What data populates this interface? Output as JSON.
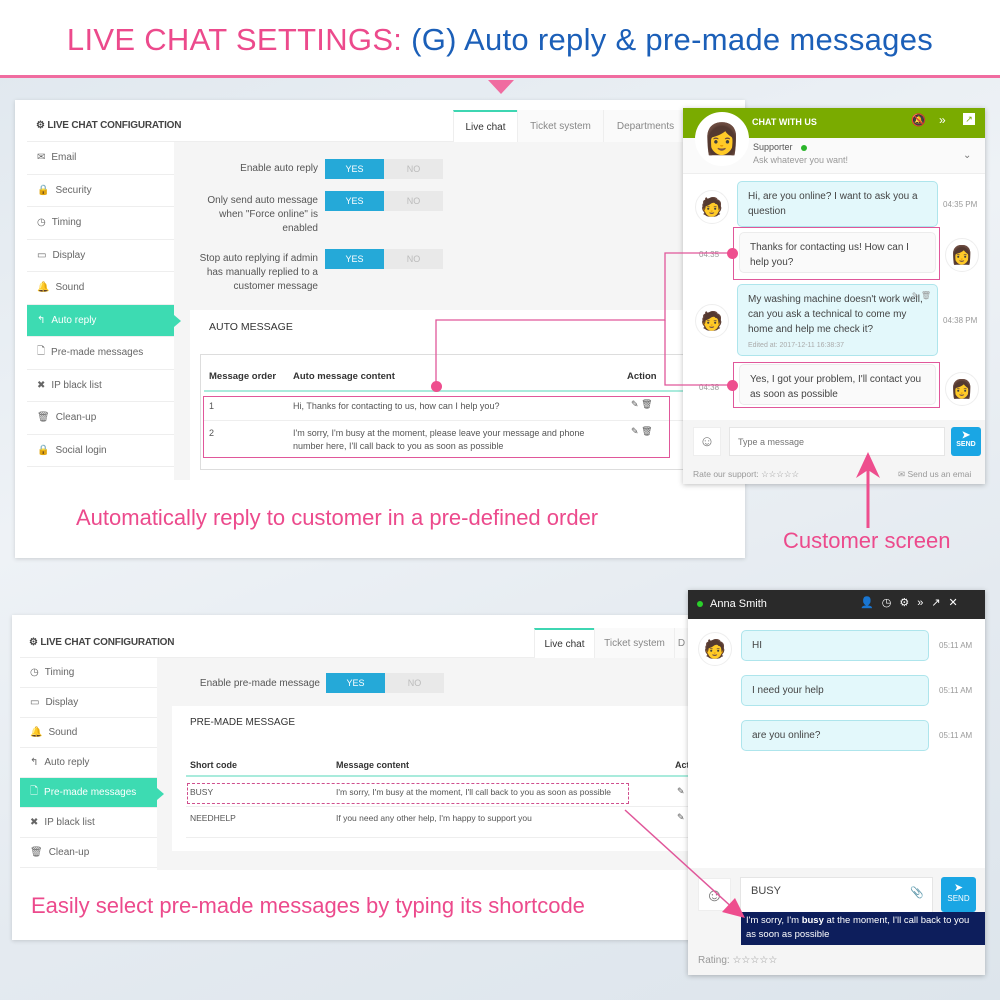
{
  "header": {
    "title_pink": "LIVE CHAT SETTINGS:",
    "title_blue": "(G) Auto reply & pre-made messages"
  },
  "colors": {
    "pink": "#ec4a8c",
    "blue": "#1b5fb8",
    "teal": "#3ddbb2",
    "toggle_yes": "#25a9d8",
    "chat_green": "#7aab00",
    "chat_dark": "#2a2a2a",
    "suggest": "#0d1e5c"
  },
  "panel1": {
    "config_title": "LIVE CHAT CONFIGURATION",
    "tabs": [
      "Live chat",
      "Ticket system",
      "Departments"
    ],
    "sidebar": [
      {
        "label": "Email",
        "icon": "envelope-icon"
      },
      {
        "label": "Security",
        "icon": "lock-icon"
      },
      {
        "label": "Timing",
        "icon": "clock-icon"
      },
      {
        "label": "Display",
        "icon": "monitor-icon"
      },
      {
        "label": "Sound",
        "icon": "bell-icon"
      },
      {
        "label": "Auto reply",
        "icon": "reply-icon",
        "active": true
      },
      {
        "label": "Pre-made messages",
        "icon": "file-icon"
      },
      {
        "label": "IP black list",
        "icon": "x-icon"
      },
      {
        "label": "Clean-up",
        "icon": "trash-icon"
      },
      {
        "label": "Social login",
        "icon": "lock-icon"
      }
    ],
    "settings": [
      {
        "label": "Enable auto reply",
        "value": "YES"
      },
      {
        "label": "Only send auto message when \"Force online\" is enabled",
        "value": "YES"
      },
      {
        "label": "Stop auto replying if admin has manually replied to a customer message",
        "value": "YES"
      }
    ],
    "toggle": {
      "yes": "YES",
      "no": "NO"
    },
    "section_title": "AUTO MESSAGE",
    "columns": [
      "Message order",
      "Auto message content",
      "Action"
    ],
    "rows": [
      {
        "order": "1",
        "content": "Hi, Thanks for contacting to us, how can I help you?"
      },
      {
        "order": "2",
        "content": "I'm sorry, I'm busy at the moment, please leave your message and phone number here, I'll call back to you as soon as possible"
      }
    ],
    "caption": "Automatically reply to customer in a pre-defined order"
  },
  "chat1": {
    "title": "CHAT WITH US",
    "agent": "Supporter",
    "tagline": "Ask whatever you want!",
    "messages": [
      {
        "from": "customer",
        "text": "Hi, are you online? I want to ask you a question",
        "time": "04:35 PM"
      },
      {
        "from": "agent",
        "text": "Thanks for contacting us! How can I help you?",
        "time": "04:35"
      },
      {
        "from": "customer",
        "text": "My washing machine doesn't work well, can you ask a technical to come my home and help me check it?",
        "edited": "Edited at: 2017-12-11 16:38:37",
        "time": "04:38 PM"
      },
      {
        "from": "agent",
        "text": "Yes, I got your problem, I'll contact you as soon as possible",
        "time": "04:38"
      }
    ],
    "placeholder": "Type a message",
    "send": "SEND",
    "rate": "Rate our support:",
    "email": "Send us an emai",
    "caption": "Customer screen"
  },
  "panel2": {
    "config_title": "LIVE CHAT CONFIGURATION",
    "tabs": [
      "Live chat",
      "Ticket system",
      "D"
    ],
    "sidebar": [
      {
        "label": "Timing",
        "icon": "clock-icon"
      },
      {
        "label": "Display",
        "icon": "monitor-icon"
      },
      {
        "label": "Sound",
        "icon": "bell-icon"
      },
      {
        "label": "Auto reply",
        "icon": "reply-icon"
      },
      {
        "label": "Pre-made messages",
        "icon": "file-icon",
        "active": true
      },
      {
        "label": "IP black list",
        "icon": "x-icon"
      },
      {
        "label": "Clean-up",
        "icon": "trash-icon"
      }
    ],
    "setting": {
      "label": "Enable pre-made message",
      "value": "YES"
    },
    "section_title": "PRE-MADE MESSAGE",
    "columns": [
      "Short code",
      "Message content",
      "Act"
    ],
    "rows": [
      {
        "code": "BUSY",
        "content": "I'm sorry, I'm busy at the moment, I'll call back to you as soon as possible"
      },
      {
        "code": "NEEDHELP",
        "content": "If you need any other help, I'm happy to support you"
      }
    ],
    "caption": "Easily select pre-made messages by typing its shortcode"
  },
  "chat2": {
    "name": "Anna Smith",
    "messages": [
      {
        "text": "HI",
        "time": "05:11 AM"
      },
      {
        "text": "I need your help",
        "time": "05:11 AM"
      },
      {
        "text": "are you online?",
        "time": "05:11 AM"
      }
    ],
    "input": "BUSY",
    "send": "SEND",
    "suggest_pre": "I'm sorry, I'm ",
    "suggest_bold": "busy",
    "suggest_post": " at the moment, I'll call back to you as soon as possible",
    "rating": "Rating:"
  }
}
